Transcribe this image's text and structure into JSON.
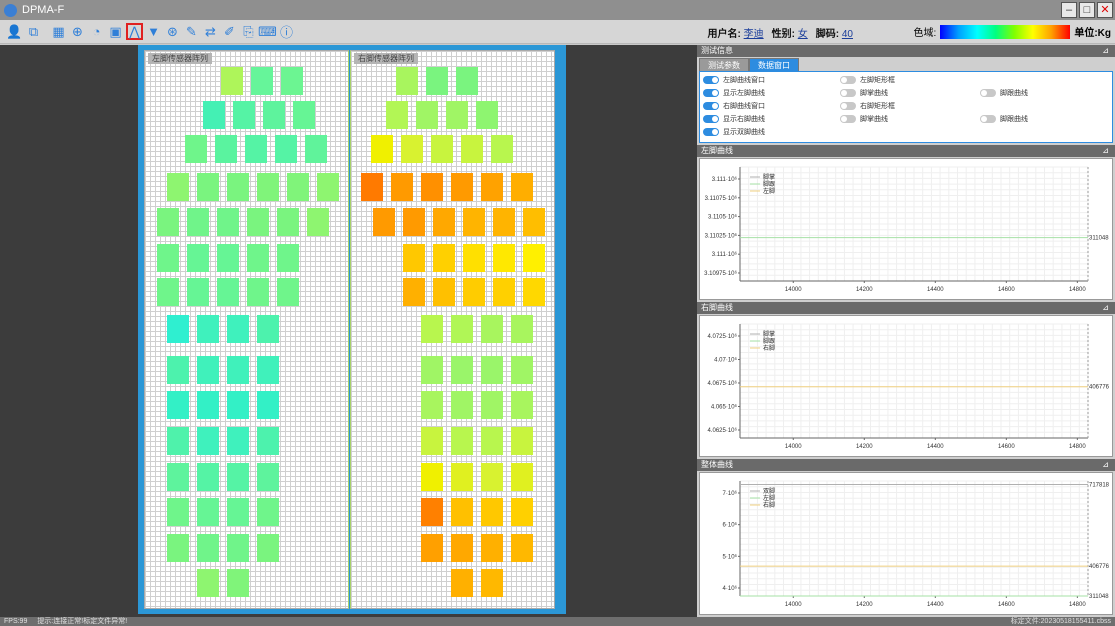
{
  "window": {
    "title": "DPMA-F"
  },
  "toolbar": {
    "icons": [
      "user-icon",
      "scan-icon",
      "grid-icon",
      "crosshair-icon",
      "hand-icon",
      "image-icon",
      "curve-icon",
      "triangle-down-icon",
      "target-icon",
      "edit-icon",
      "swap-icon",
      "brush-icon",
      "export-icon",
      "keyboard-icon",
      "info-icon"
    ]
  },
  "user": {
    "name_label": "用户名:",
    "name": "李迪",
    "gender_label": "性别:",
    "gender": "女",
    "shoe_label": "脚码:",
    "shoe": "40"
  },
  "colorbar": {
    "label": "色域:",
    "unit": "单位:Kg"
  },
  "left_panel_label": "左脚传感器阵列",
  "right_panel_label": "右脚传感器阵列",
  "sensors": {
    "left": [
      {
        "c": "#aef55a"
      },
      {
        "c": "#66f59a"
      },
      {
        "c": "#6cf592"
      },
      {
        "c": "#44f0b4"
      },
      {
        "c": "#55f3a5"
      },
      {
        "c": "#5ef39d"
      },
      {
        "c": "#66f595"
      },
      {
        "c": "#6ff58b"
      },
      {
        "c": "#5af39f"
      },
      {
        "c": "#55f3a5"
      },
      {
        "c": "#55f3a5"
      },
      {
        "c": "#60f39b"
      },
      {
        "c": "#8ef570"
      },
      {
        "c": "#7af47f"
      },
      {
        "c": "#7af47f"
      },
      {
        "c": "#80f47a"
      },
      {
        "c": "#80f47a"
      },
      {
        "c": "#8ef570"
      },
      {
        "c": "#7af47f"
      },
      {
        "c": "#70f48a"
      },
      {
        "c": "#70f48a"
      },
      {
        "c": "#7af47f"
      },
      {
        "c": "#7af47f"
      },
      {
        "c": "#8ef570"
      },
      {
        "c": "#6ff58b"
      },
      {
        "c": "#66f595"
      },
      {
        "c": "#66f595"
      },
      {
        "c": "#6ff58b"
      },
      {
        "c": "#6ff58b"
      },
      {
        "c": "#6ff58b"
      },
      {
        "c": "#66f595"
      },
      {
        "c": "#66f595"
      },
      {
        "c": "#6ff58b"
      },
      {
        "c": "#6ff58b"
      },
      {
        "c": "#2fefd0"
      },
      {
        "c": "#3ff1bd"
      },
      {
        "c": "#3ff1bd"
      },
      {
        "c": "#4df2ad"
      },
      {
        "c": "#4df2ad"
      },
      {
        "c": "#40f1bb"
      },
      {
        "c": "#40f1bb"
      },
      {
        "c": "#40f1bb"
      },
      {
        "c": "#33f0c6"
      },
      {
        "c": "#33f0c6"
      },
      {
        "c": "#33f0c6"
      },
      {
        "c": "#33f0c6"
      },
      {
        "c": "#4ff2ab"
      },
      {
        "c": "#3ff1bd"
      },
      {
        "c": "#3ff1bd"
      },
      {
        "c": "#4df2ad"
      },
      {
        "c": "#5ef39d"
      },
      {
        "c": "#55f3a5"
      },
      {
        "c": "#55f3a5"
      },
      {
        "c": "#5ef39d"
      },
      {
        "c": "#6ff58b"
      },
      {
        "c": "#66f595"
      },
      {
        "c": "#66f595"
      },
      {
        "c": "#6ff58b"
      },
      {
        "c": "#7af47f"
      },
      {
        "c": "#70f48a"
      },
      {
        "c": "#70f48a"
      },
      {
        "c": "#7af47f"
      },
      {
        "c": "#8ef570"
      },
      {
        "c": "#80f47a"
      }
    ],
    "right": [
      {
        "c": "#a8f55e"
      },
      {
        "c": "#7af47f"
      },
      {
        "c": "#7af47f"
      },
      {
        "c": "#b2f655"
      },
      {
        "c": "#a0f565"
      },
      {
        "c": "#a0f565"
      },
      {
        "c": "#8ef570"
      },
      {
        "c": "#f0f000"
      },
      {
        "c": "#d8f230"
      },
      {
        "c": "#c8f43e"
      },
      {
        "c": "#c8f43e"
      },
      {
        "c": "#b8f64e"
      },
      {
        "c": "#ff7a00"
      },
      {
        "c": "#ff9a00"
      },
      {
        "c": "#ff9000"
      },
      {
        "c": "#ff9a00"
      },
      {
        "c": "#ffa200"
      },
      {
        "c": "#ffae00"
      },
      {
        "c": "#ff9a00"
      },
      {
        "c": "#ff9a00"
      },
      {
        "c": "#ffa800"
      },
      {
        "c": "#ffb400"
      },
      {
        "c": "#ffb400"
      },
      {
        "c": "#ffbe00"
      },
      {
        "c": "#ffc800"
      },
      {
        "c": "#ffd000"
      },
      {
        "c": "#ffe000"
      },
      {
        "c": "#ffe800"
      },
      {
        "c": "#fff000"
      },
      {
        "c": "#ffb000"
      },
      {
        "c": "#ffc000"
      },
      {
        "c": "#ffcc00"
      },
      {
        "c": "#ffd000"
      },
      {
        "c": "#ffd800"
      },
      {
        "c": "#b8f64e"
      },
      {
        "c": "#b0f656"
      },
      {
        "c": "#a8f55e"
      },
      {
        "c": "#a8f55e"
      },
      {
        "c": "#a0f565"
      },
      {
        "c": "#9af56a"
      },
      {
        "c": "#9af56a"
      },
      {
        "c": "#a0f565"
      },
      {
        "c": "#a8f55e"
      },
      {
        "c": "#a0f565"
      },
      {
        "c": "#a0f565"
      },
      {
        "c": "#a8f55e"
      },
      {
        "c": "#c8f43e"
      },
      {
        "c": "#b8f64e"
      },
      {
        "c": "#b8f64e"
      },
      {
        "c": "#c8f43e"
      },
      {
        "c": "#f0f000"
      },
      {
        "c": "#e0f020"
      },
      {
        "c": "#d8f230"
      },
      {
        "c": "#e0f020"
      },
      {
        "c": "#ff8000"
      },
      {
        "c": "#ffc000"
      },
      {
        "c": "#ffc800"
      },
      {
        "c": "#ffd000"
      },
      {
        "c": "#ffa000"
      },
      {
        "c": "#ffa800"
      },
      {
        "c": "#ffb000"
      },
      {
        "c": "#ffb800"
      },
      {
        "c": "#ffb000"
      },
      {
        "c": "#ffb800"
      }
    ]
  },
  "dock": {
    "header": "测试信息",
    "tabs": [
      "测试参数",
      "数据窗口"
    ],
    "options": [
      {
        "label": "左脚曲线窗口",
        "on": true
      },
      {
        "label": "左脚矩形框",
        "on": false
      },
      {
        "label": "显示左脚曲线",
        "on": true
      },
      {
        "label": "脚掌曲线",
        "on": false
      },
      {
        "label": "脚跟曲线",
        "on": false
      },
      {
        "label": "右脚曲线窗口",
        "on": true
      },
      {
        "label": "右脚矩形框",
        "on": false
      },
      {
        "label": "显示右脚曲线",
        "on": true
      },
      {
        "label": "脚掌曲线",
        "on": false
      },
      {
        "label": "脚跟曲线",
        "on": false
      },
      {
        "label": "显示双脚曲线",
        "on": true
      }
    ]
  },
  "chart_data": [
    {
      "type": "line",
      "title": "左脚曲线",
      "legend": [
        "脚掌",
        "脚跟",
        "左脚"
      ],
      "y_ticks": [
        "3.111·10⁶",
        "3.11075·10⁶",
        "3.1105·10⁶",
        "3.11025·10⁶",
        "3.111·10⁶",
        "3.10975·10⁶"
      ],
      "x_ticks": [
        14000,
        14200,
        14400,
        14600,
        14800
      ],
      "xlim": [
        13850,
        14830
      ],
      "series": [
        {
          "name": "左脚",
          "color": "#a6e0a6",
          "level": 0.62
        }
      ],
      "right_label": "311048"
    },
    {
      "type": "line",
      "title": "右脚曲线",
      "legend": [
        "脚掌",
        "脚跟",
        "右脚"
      ],
      "y_ticks": [
        "4.0725·10⁶",
        "4.07·10⁶",
        "4.0675·10⁶",
        "4.065·10⁶",
        "4.0625·10⁶"
      ],
      "x_ticks": [
        14000,
        14200,
        14400,
        14600,
        14800
      ],
      "xlim": [
        13850,
        14830
      ],
      "series": [
        {
          "name": "右脚",
          "color": "#f0d080",
          "level": 0.55
        }
      ],
      "right_label": "406776"
    },
    {
      "type": "line",
      "title": "整体曲线",
      "legend": [
        "双脚",
        "左脚",
        "右脚"
      ],
      "y_ticks": [
        "7·10⁶",
        "6·10⁶",
        "5·10⁶",
        "4·10⁶"
      ],
      "x_ticks": [
        14000,
        14200,
        14400,
        14600,
        14800
      ],
      "xlim": [
        13850,
        14830
      ],
      "series": [
        {
          "name": "双脚",
          "color": "#b0b0b0",
          "level": 0.03
        },
        {
          "name": "右脚",
          "color": "#f0d080",
          "level": 0.74
        },
        {
          "name": "左脚",
          "color": "#a6e0a6",
          "level": 1.0
        }
      ],
      "right_labels": [
        "717818",
        "406776",
        "311048"
      ]
    }
  ],
  "status": {
    "fps": "FPS:99",
    "message": "提示:连接正常!标定文件异常!",
    "file": "标定文件:20230518155411.cbss"
  }
}
